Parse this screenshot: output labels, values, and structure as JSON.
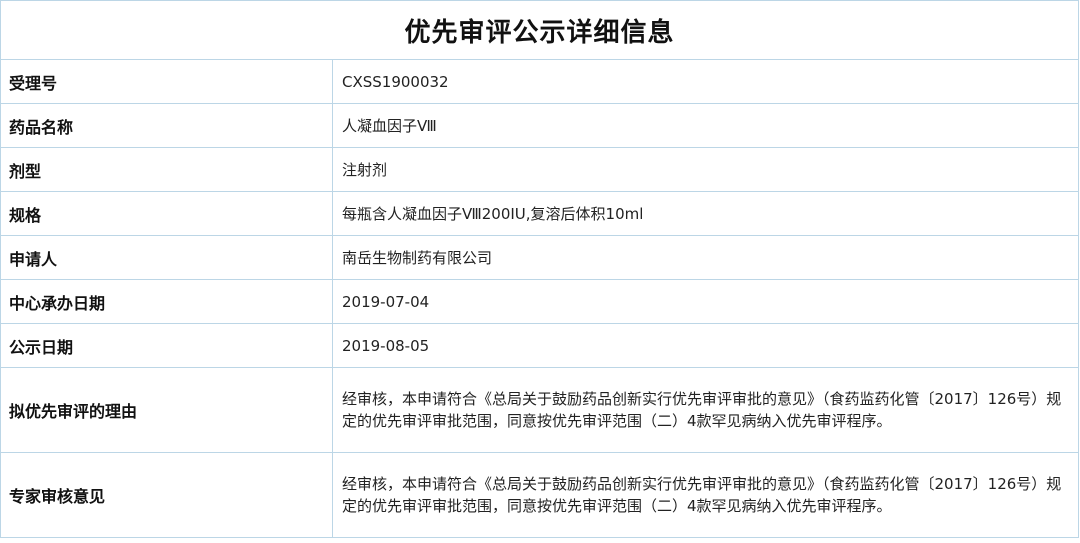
{
  "page": {
    "title": "优先审评公示详细信息"
  },
  "rows": [
    {
      "label": "受理号",
      "value": "CXSS1900032"
    },
    {
      "label": "药品名称",
      "value": "人凝血因子Ⅷ"
    },
    {
      "label": "剂型",
      "value": "注射剂"
    },
    {
      "label": "规格",
      "value": "每瓶含人凝血因子Ⅷ200IU,复溶后体积10ml"
    },
    {
      "label": "申请人",
      "value": "南岳生物制药有限公司"
    },
    {
      "label": "中心承办日期",
      "value": "2019-07-04"
    },
    {
      "label": "公示日期",
      "value": "2019-08-05"
    },
    {
      "label": "拟优先审评的理由",
      "value": "经审核，本申请符合《总局关于鼓励药品创新实行优先审评审批的意见》（食药监药化管〔2017〕126号）规定的优先审评审批范围，同意按优先审评范围（二）4款罕见病纳入优先审评程序。"
    },
    {
      "label": "专家审核意见",
      "value": "经审核，本申请符合《总局关于鼓励药品创新实行优先审评审批的意见》（食药监药化管〔2017〕126号）规定的优先审评审批范围，同意按优先审评范围（二）4款罕见病纳入优先审评程序。"
    }
  ]
}
